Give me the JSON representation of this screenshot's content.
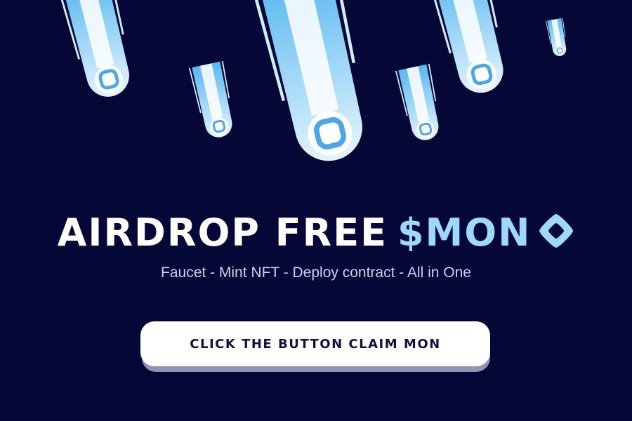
{
  "banner": {
    "headline_white": "AIRDROP FREE",
    "headline_blue": "$MON",
    "logo_icon": "monad-diamond-icon",
    "subtitle": "Faucet - Mint NFT - Deploy contract - All in One",
    "decoration_icon": "falling-comet-icon"
  },
  "cta": {
    "label": "CLICK THE BUTTON CLAIM MON"
  },
  "colors": {
    "background": "#050736",
    "accent_light_blue": "#9fd8ff",
    "comet_blue": "#6ec3f4",
    "button_bg": "#ffffff",
    "button_text": "#11133f"
  }
}
